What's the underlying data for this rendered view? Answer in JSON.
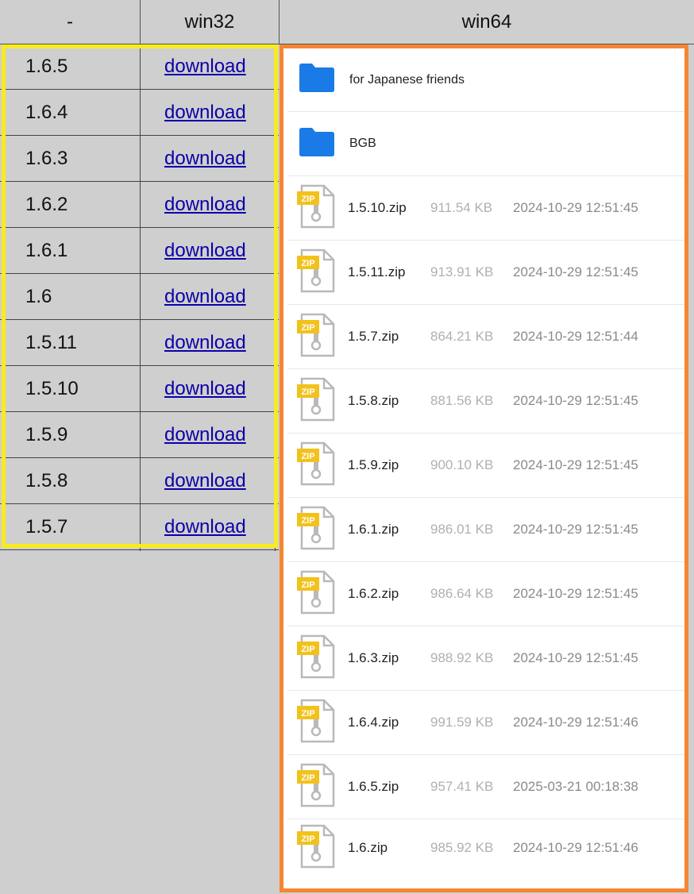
{
  "header": {
    "col0": "-",
    "col1": "win32",
    "col2": "win64"
  },
  "win32_rows": [
    {
      "version": "1.6.5",
      "link": "download"
    },
    {
      "version": "1.6.4",
      "link": "download"
    },
    {
      "version": "1.6.3",
      "link": "download"
    },
    {
      "version": "1.6.2",
      "link": "download"
    },
    {
      "version": "1.6.1",
      "link": "download"
    },
    {
      "version": "1.6",
      "link": "download"
    },
    {
      "version": "1.5.11",
      "link": "download"
    },
    {
      "version": "1.5.10",
      "link": "download"
    },
    {
      "version": "1.5.9",
      "link": "download"
    },
    {
      "version": "1.5.8",
      "link": "download"
    },
    {
      "version": "1.5.7",
      "link": "download"
    }
  ],
  "win64": {
    "folders": [
      {
        "name": "for Japanese friends"
      },
      {
        "name": "BGB"
      }
    ],
    "files": [
      {
        "name": "1.5.10.zip",
        "size": "911.54 KB",
        "date": "2024-10-29 12:51:45"
      },
      {
        "name": "1.5.11.zip",
        "size": "913.91 KB",
        "date": "2024-10-29 12:51:45"
      },
      {
        "name": "1.5.7.zip",
        "size": "864.21 KB",
        "date": "2024-10-29 12:51:44"
      },
      {
        "name": "1.5.8.zip",
        "size": "881.56 KB",
        "date": "2024-10-29 12:51:45"
      },
      {
        "name": "1.5.9.zip",
        "size": "900.10 KB",
        "date": "2024-10-29 12:51:45"
      },
      {
        "name": "1.6.1.zip",
        "size": "986.01 KB",
        "date": "2024-10-29 12:51:45"
      },
      {
        "name": "1.6.2.zip",
        "size": "986.64 KB",
        "date": "2024-10-29 12:51:45"
      },
      {
        "name": "1.6.3.zip",
        "size": "988.92 KB",
        "date": "2024-10-29 12:51:45"
      },
      {
        "name": "1.6.4.zip",
        "size": "991.59 KB",
        "date": "2024-10-29 12:51:46"
      },
      {
        "name": "1.6.5.zip",
        "size": "957.41 KB",
        "date": "2025-03-21 00:18:38"
      },
      {
        "name": "1.6.zip",
        "size": "985.92 KB",
        "date": "2024-10-29 12:51:46"
      }
    ],
    "zip_badge": "ZIP"
  },
  "icons": {
    "folder": "folder-icon",
    "zip": "zip-file-icon"
  },
  "colors": {
    "highlight_win32": "#f7ec1d",
    "highlight_win64": "#f68631",
    "folder_blue": "#1a7be6",
    "zip_yellow": "#f2c21b",
    "link": "#0b00a8"
  }
}
